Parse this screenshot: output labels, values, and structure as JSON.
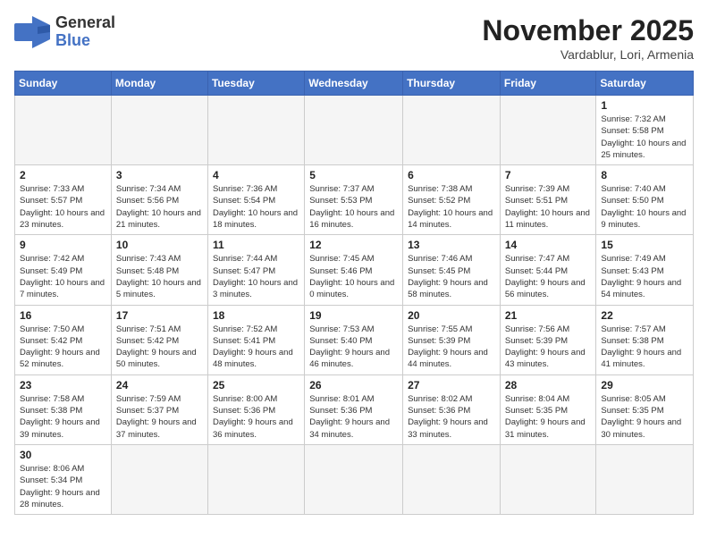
{
  "header": {
    "logo_general": "General",
    "logo_blue": "Blue",
    "month_title": "November 2025",
    "location": "Vardablur, Lori, Armenia"
  },
  "weekdays": [
    "Sunday",
    "Monday",
    "Tuesday",
    "Wednesday",
    "Thursday",
    "Friday",
    "Saturday"
  ],
  "weeks": [
    [
      {
        "day": "",
        "info": ""
      },
      {
        "day": "",
        "info": ""
      },
      {
        "day": "",
        "info": ""
      },
      {
        "day": "",
        "info": ""
      },
      {
        "day": "",
        "info": ""
      },
      {
        "day": "",
        "info": ""
      },
      {
        "day": "1",
        "info": "Sunrise: 7:32 AM\nSunset: 5:58 PM\nDaylight: 10 hours\nand 25 minutes."
      }
    ],
    [
      {
        "day": "2",
        "info": "Sunrise: 7:33 AM\nSunset: 5:57 PM\nDaylight: 10 hours\nand 23 minutes."
      },
      {
        "day": "3",
        "info": "Sunrise: 7:34 AM\nSunset: 5:56 PM\nDaylight: 10 hours\nand 21 minutes."
      },
      {
        "day": "4",
        "info": "Sunrise: 7:36 AM\nSunset: 5:54 PM\nDaylight: 10 hours\nand 18 minutes."
      },
      {
        "day": "5",
        "info": "Sunrise: 7:37 AM\nSunset: 5:53 PM\nDaylight: 10 hours\nand 16 minutes."
      },
      {
        "day": "6",
        "info": "Sunrise: 7:38 AM\nSunset: 5:52 PM\nDaylight: 10 hours\nand 14 minutes."
      },
      {
        "day": "7",
        "info": "Sunrise: 7:39 AM\nSunset: 5:51 PM\nDaylight: 10 hours\nand 11 minutes."
      },
      {
        "day": "8",
        "info": "Sunrise: 7:40 AM\nSunset: 5:50 PM\nDaylight: 10 hours\nand 9 minutes."
      }
    ],
    [
      {
        "day": "9",
        "info": "Sunrise: 7:42 AM\nSunset: 5:49 PM\nDaylight: 10 hours\nand 7 minutes."
      },
      {
        "day": "10",
        "info": "Sunrise: 7:43 AM\nSunset: 5:48 PM\nDaylight: 10 hours\nand 5 minutes."
      },
      {
        "day": "11",
        "info": "Sunrise: 7:44 AM\nSunset: 5:47 PM\nDaylight: 10 hours\nand 3 minutes."
      },
      {
        "day": "12",
        "info": "Sunrise: 7:45 AM\nSunset: 5:46 PM\nDaylight: 10 hours\nand 0 minutes."
      },
      {
        "day": "13",
        "info": "Sunrise: 7:46 AM\nSunset: 5:45 PM\nDaylight: 9 hours\nand 58 minutes."
      },
      {
        "day": "14",
        "info": "Sunrise: 7:47 AM\nSunset: 5:44 PM\nDaylight: 9 hours\nand 56 minutes."
      },
      {
        "day": "15",
        "info": "Sunrise: 7:49 AM\nSunset: 5:43 PM\nDaylight: 9 hours\nand 54 minutes."
      }
    ],
    [
      {
        "day": "16",
        "info": "Sunrise: 7:50 AM\nSunset: 5:42 PM\nDaylight: 9 hours\nand 52 minutes."
      },
      {
        "day": "17",
        "info": "Sunrise: 7:51 AM\nSunset: 5:42 PM\nDaylight: 9 hours\nand 50 minutes."
      },
      {
        "day": "18",
        "info": "Sunrise: 7:52 AM\nSunset: 5:41 PM\nDaylight: 9 hours\nand 48 minutes."
      },
      {
        "day": "19",
        "info": "Sunrise: 7:53 AM\nSunset: 5:40 PM\nDaylight: 9 hours\nand 46 minutes."
      },
      {
        "day": "20",
        "info": "Sunrise: 7:55 AM\nSunset: 5:39 PM\nDaylight: 9 hours\nand 44 minutes."
      },
      {
        "day": "21",
        "info": "Sunrise: 7:56 AM\nSunset: 5:39 PM\nDaylight: 9 hours\nand 43 minutes."
      },
      {
        "day": "22",
        "info": "Sunrise: 7:57 AM\nSunset: 5:38 PM\nDaylight: 9 hours\nand 41 minutes."
      }
    ],
    [
      {
        "day": "23",
        "info": "Sunrise: 7:58 AM\nSunset: 5:38 PM\nDaylight: 9 hours\nand 39 minutes."
      },
      {
        "day": "24",
        "info": "Sunrise: 7:59 AM\nSunset: 5:37 PM\nDaylight: 9 hours\nand 37 minutes."
      },
      {
        "day": "25",
        "info": "Sunrise: 8:00 AM\nSunset: 5:36 PM\nDaylight: 9 hours\nand 36 minutes."
      },
      {
        "day": "26",
        "info": "Sunrise: 8:01 AM\nSunset: 5:36 PM\nDaylight: 9 hours\nand 34 minutes."
      },
      {
        "day": "27",
        "info": "Sunrise: 8:02 AM\nSunset: 5:36 PM\nDaylight: 9 hours\nand 33 minutes."
      },
      {
        "day": "28",
        "info": "Sunrise: 8:04 AM\nSunset: 5:35 PM\nDaylight: 9 hours\nand 31 minutes."
      },
      {
        "day": "29",
        "info": "Sunrise: 8:05 AM\nSunset: 5:35 PM\nDaylight: 9 hours\nand 30 minutes."
      }
    ],
    [
      {
        "day": "30",
        "info": "Sunrise: 8:06 AM\nSunset: 5:34 PM\nDaylight: 9 hours\nand 28 minutes."
      },
      {
        "day": "",
        "info": ""
      },
      {
        "day": "",
        "info": ""
      },
      {
        "day": "",
        "info": ""
      },
      {
        "day": "",
        "info": ""
      },
      {
        "day": "",
        "info": ""
      },
      {
        "day": "",
        "info": ""
      }
    ]
  ]
}
